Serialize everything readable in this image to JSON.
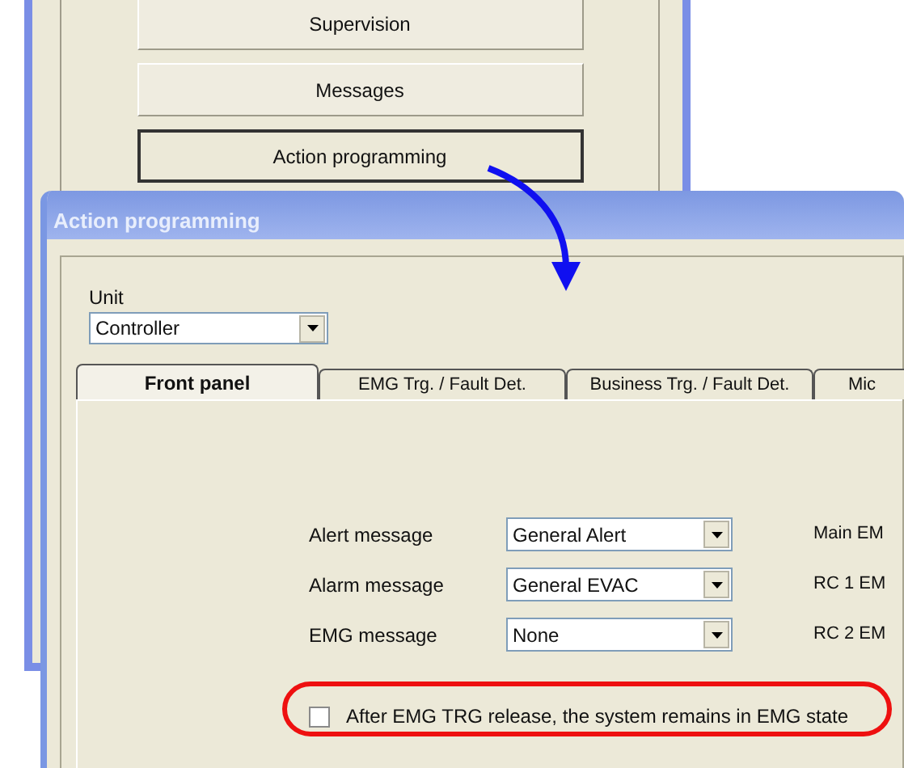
{
  "background_window": {
    "buttons": [
      {
        "label": "Supervision",
        "selected": false
      },
      {
        "label": "Messages",
        "selected": false
      },
      {
        "label": "Action programming",
        "selected": true
      }
    ]
  },
  "window": {
    "title": "Action programming"
  },
  "unit": {
    "label": "Unit",
    "value": "Controller"
  },
  "tabs": [
    {
      "label": "Front panel",
      "selected": true
    },
    {
      "label": "EMG Trg. / Fault Det.",
      "selected": false
    },
    {
      "label": "Business Trg. / Fault Det.",
      "selected": false
    },
    {
      "label": "Mic",
      "selected": false
    }
  ],
  "messages": [
    {
      "label": "Alert message",
      "value": "General Alert",
      "side_label": "Main EM"
    },
    {
      "label": "Alarm message",
      "value": "General EVAC",
      "side_label": "RC 1 EM"
    },
    {
      "label": "EMG message",
      "value": "None",
      "side_label": "RC 2 EM"
    }
  ],
  "checkbox": {
    "label": "After EMG TRG release, the system remains in EMG state",
    "checked": false
  }
}
